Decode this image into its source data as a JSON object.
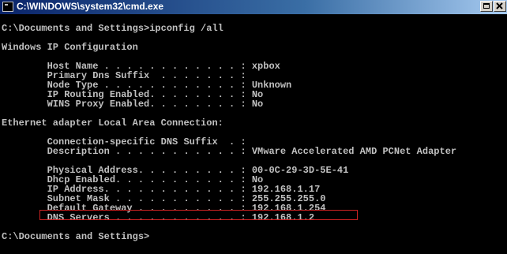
{
  "window": {
    "title": "C:\\WINDOWS\\system32\\cmd.exe",
    "icon": "cmd-console-icon",
    "maximize_icon": "maximize-icon",
    "close_icon": "close-icon"
  },
  "console": {
    "lines": [
      "",
      "C:\\Documents and Settings>ipconfig /all",
      "",
      "Windows IP Configuration",
      "",
      "        Host Name . . . . . . . . . . . . : xpbox",
      "        Primary Dns Suffix  . . . . . . . :",
      "        Node Type . . . . . . . . . . . . : Unknown",
      "        IP Routing Enabled. . . . . . . . : No",
      "        WINS Proxy Enabled. . . . . . . . : No",
      "",
      "Ethernet adapter Local Area Connection:",
      "",
      "        Connection-specific DNS Suffix  . :",
      "        Description . . . . . . . . . . . : VMware Accelerated AMD PCNet Adapter",
      "",
      "        Physical Address. . . . . . . . . : 00-0C-29-3D-5E-41",
      "        Dhcp Enabled. . . . . . . . . . . : No",
      "        IP Address. . . . . . . . . . . . : 192.168.1.17",
      "        Subnet Mask . . . . . . . . . . . : 255.255.255.0",
      "        Default Gateway . . . . . . . . . : 192.168.1.254",
      "        DNS Servers . . . . . . . . . . . : 192.168.1.2",
      "",
      "C:\\Documents and Settings>"
    ]
  },
  "colors": {
    "console_bg": "#000000",
    "console_text": "#c0c0c0",
    "highlight_border": "#cc2222",
    "titlebar_start": "#0a246a",
    "titlebar_end": "#a6caf0"
  }
}
